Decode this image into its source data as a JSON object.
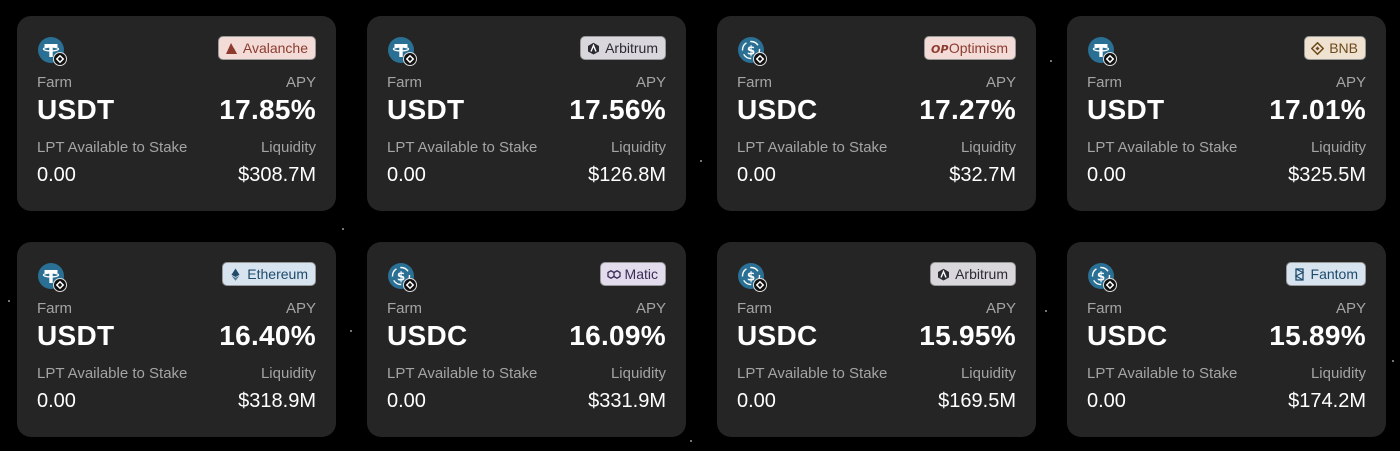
{
  "labels": {
    "farm": "Farm",
    "apy": "APY",
    "lpt": "LPT Available to Stake",
    "liquidity": "Liquidity"
  },
  "colors": {
    "card_bg": "#252525",
    "page_bg": "#000000",
    "label": "#a4a4a4",
    "usdt_icon": "#2a6f94",
    "usdc_icon": "#2a6f94"
  },
  "cards": [
    {
      "token": "USDT",
      "token_icon": "usdt-icon",
      "chain": "Avalanche",
      "chain_icon": "avalanche-icon",
      "chain_bg": "#f3dcd8",
      "chain_fg": "#8c3b2e",
      "apy": "17.85%",
      "lpt": "0.00",
      "liquidity": "$308.7M"
    },
    {
      "token": "USDT",
      "token_icon": "usdt-icon",
      "chain": "Arbitrum",
      "chain_icon": "arbitrum-icon",
      "chain_bg": "#d9d7dc",
      "chain_fg": "#2b2b33",
      "apy": "17.56%",
      "lpt": "0.00",
      "liquidity": "$126.8M"
    },
    {
      "token": "USDC",
      "token_icon": "usdc-icon",
      "chain": "Optimism",
      "chain_icon": "optimism-icon",
      "chain_bg": "#f3dcd8",
      "chain_fg": "#8c3b2e",
      "apy": "17.27%",
      "lpt": "0.00",
      "liquidity": "$32.7M"
    },
    {
      "token": "USDT",
      "token_icon": "usdt-icon",
      "chain": "BNB",
      "chain_icon": "bnb-icon",
      "chain_bg": "#efe2d0",
      "chain_fg": "#6d4a1c",
      "apy": "17.01%",
      "lpt": "0.00",
      "liquidity": "$325.5M"
    },
    {
      "token": "USDT",
      "token_icon": "usdt-icon",
      "chain": "Ethereum",
      "chain_icon": "ethereum-icon",
      "chain_bg": "#d7e4ef",
      "chain_fg": "#1f4a6b",
      "apy": "16.40%",
      "lpt": "0.00",
      "liquidity": "$318.9M"
    },
    {
      "token": "USDC",
      "token_icon": "usdc-icon",
      "chain": "Matic",
      "chain_icon": "matic-icon",
      "chain_bg": "#e2dced",
      "chain_fg": "#3b2d57",
      "apy": "16.09%",
      "lpt": "0.00",
      "liquidity": "$331.9M"
    },
    {
      "token": "USDC",
      "token_icon": "usdc-icon",
      "chain": "Arbitrum",
      "chain_icon": "arbitrum-icon",
      "chain_bg": "#d9d7dc",
      "chain_fg": "#2b2b33",
      "apy": "15.95%",
      "lpt": "0.00",
      "liquidity": "$169.5M"
    },
    {
      "token": "USDC",
      "token_icon": "usdc-icon",
      "chain": "Fantom",
      "chain_icon": "fantom-icon",
      "chain_bg": "#d7e4ef",
      "chain_fg": "#1f4a6b",
      "apy": "15.89%",
      "lpt": "0.00",
      "liquidity": "$174.2M"
    }
  ]
}
